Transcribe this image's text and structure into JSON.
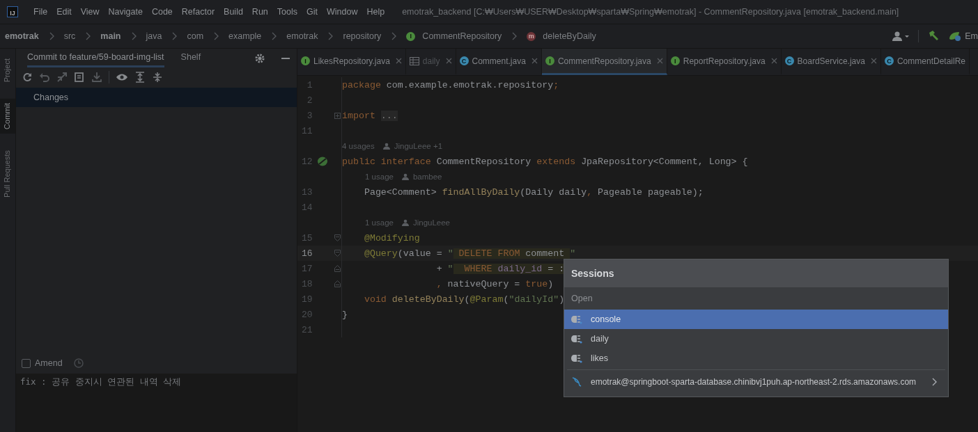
{
  "app_logo": "IJ",
  "menu": [
    "File",
    "Edit",
    "View",
    "Navigate",
    "Code",
    "Refactor",
    "Build",
    "Run",
    "Tools",
    "Git",
    "Window",
    "Help"
  ],
  "window": {
    "title": "emotrak_backend [C:₩Users₩USER₩Desktop₩sparta₩Spring₩emotrak] - CommentRepository.java [emotrak_backend.main]"
  },
  "breadcrumbs": [
    {
      "label": "emotrak",
      "kind": "bold"
    },
    {
      "label": "src",
      "kind": "plain"
    },
    {
      "label": "main",
      "kind": "bold"
    },
    {
      "label": "java",
      "kind": "plain"
    },
    {
      "label": "com",
      "kind": "plain"
    },
    {
      "label": "example",
      "kind": "plain"
    },
    {
      "label": "emotrak",
      "kind": "plain"
    },
    {
      "label": "repository",
      "kind": "plain"
    },
    {
      "label": "CommentRepository",
      "kind": "interface",
      "icon": "I"
    },
    {
      "label": "deleteByDaily",
      "kind": "method",
      "icon": "m"
    }
  ],
  "toolbar": {
    "run_config": "Em"
  },
  "side_tabs": [
    {
      "label": "Project",
      "selected": false
    },
    {
      "label": "Commit",
      "selected": true
    },
    {
      "label": "Pull Requests",
      "selected": false
    }
  ],
  "commit_panel": {
    "tabs": [
      {
        "label": "Commit to feature/59-board-img-list",
        "selected": true
      },
      {
        "label": "Shelf",
        "selected": false
      }
    ],
    "changes": "Changes",
    "amend": {
      "label": "Amend",
      "checked": false
    },
    "message": "fix : 공유 중지시 연관된 내역 삭제"
  },
  "editor_tabs": [
    {
      "label": "LikesRepository.java",
      "kind": "interface",
      "icon": "I",
      "selected": false
    },
    {
      "label": "daily",
      "kind": "table",
      "selected": false
    },
    {
      "label": "Comment.java",
      "kind": "class",
      "icon": "C",
      "selected": false
    },
    {
      "label": "CommentRepository.java",
      "kind": "interface",
      "icon": "I",
      "selected": true
    },
    {
      "label": "ReportRepository.java",
      "kind": "interface",
      "icon": "I",
      "selected": false
    },
    {
      "label": "BoardService.java",
      "kind": "class",
      "icon": "C",
      "selected": false
    },
    {
      "label": "CommentDetailRe",
      "kind": "class",
      "icon": "C",
      "selected": false
    }
  ],
  "code": [
    {
      "kind": "line",
      "number": "1",
      "current": false,
      "bean": false,
      "folded": false,
      "fold_start": false,
      "fold_end": false,
      "tokens": [
        {
          "kind": "kw",
          "text": "package"
        },
        {
          "kind": "plain",
          "text": " com.example.emotrak.repository"
        },
        {
          "kind": "kw",
          "text": ";"
        }
      ]
    },
    {
      "kind": "line",
      "number": "2",
      "current": false,
      "bean": false,
      "folded": false,
      "fold_start": false,
      "fold_end": false
    },
    {
      "kind": "line",
      "number": "3",
      "current": false,
      "bean": false,
      "folded": true,
      "fold_start": false,
      "fold_end": false,
      "tokens": [
        {
          "kind": "kw",
          "text": "import "
        },
        {
          "kind": "folded",
          "text": "..."
        }
      ]
    },
    {
      "kind": "line",
      "number": "11",
      "current": false,
      "bean": false,
      "folded": false,
      "fold_start": false,
      "fold_end": false
    },
    {
      "kind": "hint",
      "indented": false,
      "usages": "4 usages",
      "author": "JinguLeee +1"
    },
    {
      "kind": "line",
      "number": "12",
      "current": false,
      "bean": true,
      "folded": false,
      "fold_start": false,
      "fold_end": false,
      "tokens": [
        {
          "kind": "kw",
          "text": "public interface "
        },
        {
          "kind": "plain",
          "text": "CommentRepository "
        },
        {
          "kind": "kw",
          "text": "extends "
        },
        {
          "kind": "plain",
          "text": "JpaRepository<Comment, Long> {"
        }
      ]
    },
    {
      "kind": "hint",
      "indented": true,
      "usages": "1 usage",
      "author": "bambee"
    },
    {
      "kind": "line",
      "number": "13",
      "current": false,
      "bean": false,
      "folded": false,
      "fold_start": false,
      "fold_end": false,
      "tokens": [
        {
          "kind": "plain",
          "text": "    Page<Comment> "
        },
        {
          "kind": "method",
          "text": "findAllByDaily"
        },
        {
          "kind": "plain",
          "text": "(Daily daily"
        },
        {
          "kind": "kw",
          "text": ","
        },
        {
          "kind": "plain",
          "text": " Pageable pageable);"
        }
      ]
    },
    {
      "kind": "line",
      "number": "14",
      "current": false,
      "bean": false,
      "folded": false,
      "fold_start": false,
      "fold_end": false
    },
    {
      "kind": "hint",
      "indented": true,
      "usages": "1 usage",
      "author": "JinguLeee"
    },
    {
      "kind": "line",
      "number": "15",
      "current": false,
      "bean": false,
      "folded": false,
      "fold_start": true,
      "fold_end": false,
      "tokens": [
        {
          "kind": "annotation",
          "text": "    @Modifying"
        }
      ]
    },
    {
      "kind": "line",
      "number": "16",
      "current": true,
      "bean": false,
      "folded": false,
      "fold_start": true,
      "fold_end": false,
      "tokens": [
        {
          "kind": "annotation",
          "text": "    @Query"
        },
        {
          "kind": "plain",
          "text": "(value = "
        },
        {
          "kind": "string",
          "text": "\""
        },
        {
          "kind": "sql-kw",
          "text": " DELETE FROM"
        },
        {
          "kind": "sql",
          "text": " comment "
        },
        {
          "kind": "string",
          "text": "\""
        }
      ]
    },
    {
      "kind": "line",
      "number": "17",
      "current": false,
      "bean": false,
      "folded": false,
      "fold_start": false,
      "fold_end": true,
      "tokens": [
        {
          "kind": "plain",
          "text": "                 + "
        },
        {
          "kind": "string",
          "text": "\""
        },
        {
          "kind": "sql-kw",
          "text": "  WHERE"
        },
        {
          "kind": "sql-col",
          "text": " daily_id"
        },
        {
          "kind": "sql",
          "text": " = :"
        }
      ]
    },
    {
      "kind": "line",
      "number": "18",
      "current": false,
      "bean": false,
      "folded": false,
      "fold_start": false,
      "fold_end": true,
      "tokens": [
        {
          "kind": "kw",
          "text": "                 ,"
        },
        {
          "kind": "plain",
          "text": " nativeQuery = "
        },
        {
          "kind": "kw",
          "text": "true"
        },
        {
          "kind": "plain",
          "text": ")"
        }
      ]
    },
    {
      "kind": "line",
      "number": "19",
      "current": false,
      "bean": false,
      "folded": false,
      "fold_start": false,
      "fold_end": false,
      "tokens": [
        {
          "kind": "kw",
          "text": "    void "
        },
        {
          "kind": "method",
          "text": "deleteByDaily"
        },
        {
          "kind": "plain",
          "text": "("
        },
        {
          "kind": "annotation",
          "text": "@Param"
        },
        {
          "kind": "plain",
          "text": "("
        },
        {
          "kind": "string",
          "text": "\"dailyId\""
        },
        {
          "kind": "plain",
          "text": ")"
        }
      ]
    },
    {
      "kind": "line",
      "number": "20",
      "current": false,
      "bean": false,
      "folded": false,
      "fold_start": false,
      "fold_end": false,
      "tokens": [
        {
          "kind": "plain",
          "text": "}"
        }
      ]
    },
    {
      "kind": "line",
      "number": "21",
      "current": false,
      "bean": false,
      "folded": false,
      "fold_start": false,
      "fold_end": false
    }
  ],
  "sessions_popup": {
    "title": "Sessions",
    "section": "Open",
    "items": [
      {
        "label": "console",
        "selected": true
      },
      {
        "label": "daily",
        "selected": false
      },
      {
        "label": "likes",
        "selected": false
      }
    ],
    "datasource": {
      "label": "emotrak@springboot-sparta-database.chinibvj1puh.ap-northeast-2.rds.amazonaws.com"
    }
  }
}
